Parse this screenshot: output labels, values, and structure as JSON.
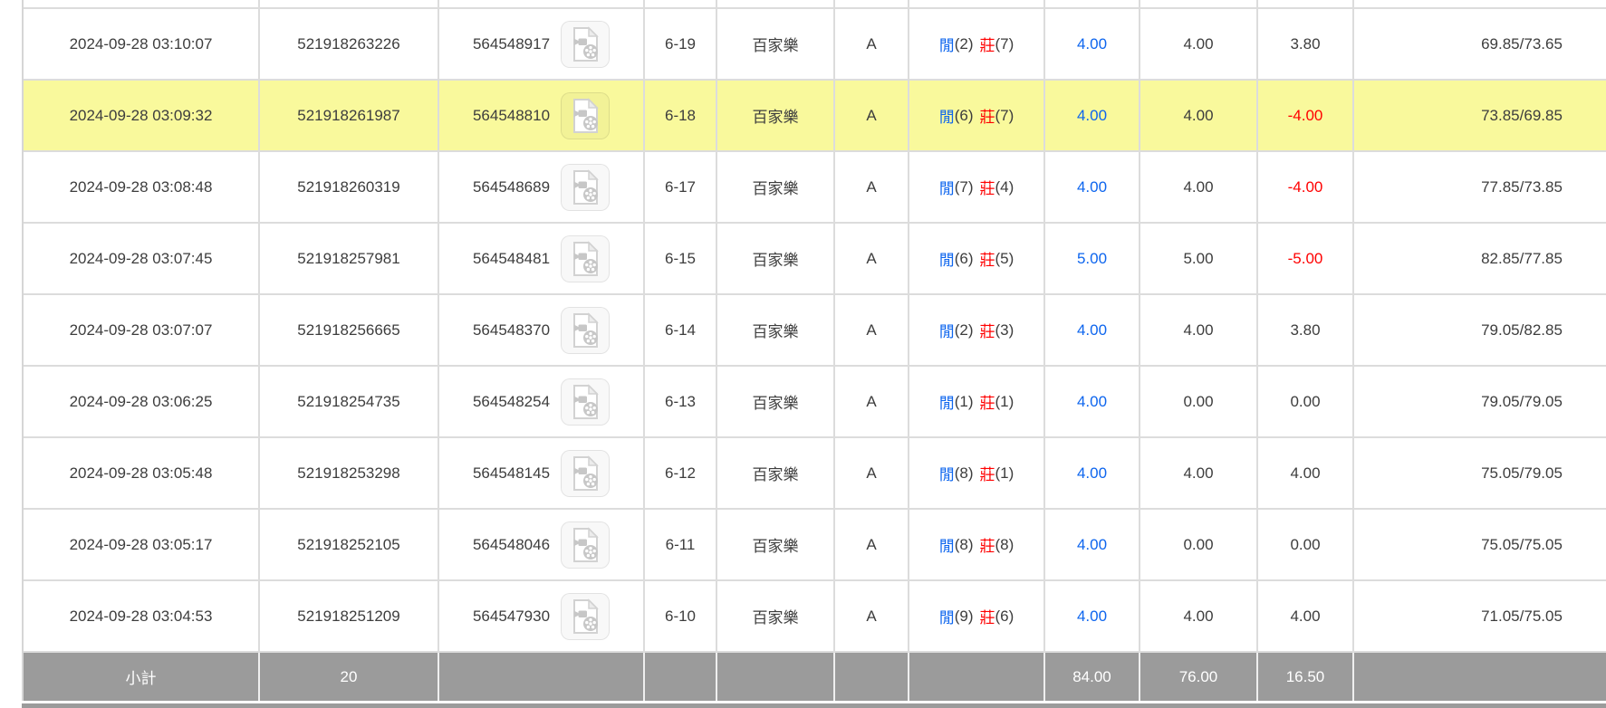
{
  "colors": {
    "player_blue": "#0d65ee",
    "banker_red": "#ff0000",
    "highlight_yellow": "#f9f99c",
    "summary_gray": "#9b9b9b",
    "negative_red": "#ff0000"
  },
  "icons": {
    "row_action": "video-replay-icon"
  },
  "table": {
    "rows": [
      {
        "time": "2024-09-28 03:10:07",
        "bet_id": "521918263226",
        "round_id": "564548917",
        "round_no": "6-19",
        "game": "百家樂",
        "table_name": "A",
        "player": "閒",
        "player_pts": "(2)",
        "banker": "莊",
        "banker_pts": "(7)",
        "bet": "4.00",
        "valid_bet": "4.00",
        "win_loss": "3.80",
        "balance": "69.85/73.65",
        "highlight": false
      },
      {
        "time": "2024-09-28 03:09:32",
        "bet_id": "521918261987",
        "round_id": "564548810",
        "round_no": "6-18",
        "game": "百家樂",
        "table_name": "A",
        "player": "閒",
        "player_pts": "(6)",
        "banker": "莊",
        "banker_pts": "(7)",
        "bet": "4.00",
        "valid_bet": "4.00",
        "win_loss": "-4.00",
        "balance": "73.85/69.85",
        "highlight": true
      },
      {
        "time": "2024-09-28 03:08:48",
        "bet_id": "521918260319",
        "round_id": "564548689",
        "round_no": "6-17",
        "game": "百家樂",
        "table_name": "A",
        "player": "閒",
        "player_pts": "(7)",
        "banker": "莊",
        "banker_pts": "(4)",
        "bet": "4.00",
        "valid_bet": "4.00",
        "win_loss": "-4.00",
        "balance": "77.85/73.85",
        "highlight": false
      },
      {
        "time": "2024-09-28 03:07:45",
        "bet_id": "521918257981",
        "round_id": "564548481",
        "round_no": "6-15",
        "game": "百家樂",
        "table_name": "A",
        "player": "閒",
        "player_pts": "(6)",
        "banker": "莊",
        "banker_pts": "(5)",
        "bet": "5.00",
        "valid_bet": "5.00",
        "win_loss": "-5.00",
        "balance": "82.85/77.85",
        "highlight": false
      },
      {
        "time": "2024-09-28 03:07:07",
        "bet_id": "521918256665",
        "round_id": "564548370",
        "round_no": "6-14",
        "game": "百家樂",
        "table_name": "A",
        "player": "閒",
        "player_pts": "(2)",
        "banker": "莊",
        "banker_pts": "(3)",
        "bet": "4.00",
        "valid_bet": "4.00",
        "win_loss": "3.80",
        "balance": "79.05/82.85",
        "highlight": false
      },
      {
        "time": "2024-09-28 03:06:25",
        "bet_id": "521918254735",
        "round_id": "564548254",
        "round_no": "6-13",
        "game": "百家樂",
        "table_name": "A",
        "player": "閒",
        "player_pts": "(1)",
        "banker": "莊",
        "banker_pts": "(1)",
        "bet": "4.00",
        "valid_bet": "0.00",
        "win_loss": "0.00",
        "balance": "79.05/79.05",
        "highlight": false
      },
      {
        "time": "2024-09-28 03:05:48",
        "bet_id": "521918253298",
        "round_id": "564548145",
        "round_no": "6-12",
        "game": "百家樂",
        "table_name": "A",
        "player": "閒",
        "player_pts": "(8)",
        "banker": "莊",
        "banker_pts": "(1)",
        "bet": "4.00",
        "valid_bet": "4.00",
        "win_loss": "4.00",
        "balance": "75.05/79.05",
        "highlight": false
      },
      {
        "time": "2024-09-28 03:05:17",
        "bet_id": "521918252105",
        "round_id": "564548046",
        "round_no": "6-11",
        "game": "百家樂",
        "table_name": "A",
        "player": "閒",
        "player_pts": "(8)",
        "banker": "莊",
        "banker_pts": "(8)",
        "bet": "4.00",
        "valid_bet": "0.00",
        "win_loss": "0.00",
        "balance": "75.05/75.05",
        "highlight": false
      },
      {
        "time": "2024-09-28 03:04:53",
        "bet_id": "521918251209",
        "round_id": "564547930",
        "round_no": "6-10",
        "game": "百家樂",
        "table_name": "A",
        "player": "閒",
        "player_pts": "(9)",
        "banker": "莊",
        "banker_pts": "(6)",
        "bet": "4.00",
        "valid_bet": "4.00",
        "win_loss": "4.00",
        "balance": "71.05/75.05",
        "highlight": false
      }
    ],
    "summary": {
      "label": "小計",
      "count": "20",
      "bet_total": "84.00",
      "valid_bet_total": "76.00",
      "win_loss_total": "16.50"
    }
  }
}
